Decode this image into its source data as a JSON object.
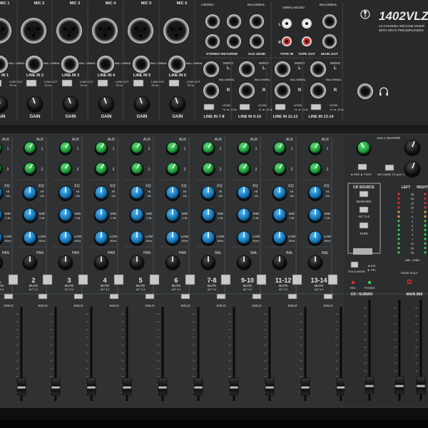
{
  "brand": {
    "model": "1402VLZ",
    "tagline_1": "14-CHANNEL MIC/LINE MIXER",
    "tagline_2": "WITH ONYX PREAMPLIFIERS"
  },
  "top_row": {
    "mic_labels": [
      "MIC 1",
      "MIC 2",
      "MIC 3",
      "MIC 4",
      "MIC 5",
      "MIC 6"
    ],
    "line_labels": [
      "LINE IN 1",
      "LINE IN 2",
      "LINE IN 3",
      "LINE IN 4",
      "LINE IN 5",
      "LINE IN 6"
    ],
    "low_cut": "LOW CUT",
    "low_cut_freq": "75 Hz",
    "gain": "GAIN",
    "bal_unbal": "BAL/ UNBAL",
    "stereo_returns": "STEREO RETURNS",
    "aux_send": "AUX SEND",
    "tape_in": "TAPE IN",
    "tape_out": "TAPE OUT",
    "main_out": "MAIN OUT",
    "unbalanced": "UNBALANCED",
    "l_mono": "L/MONO",
    "bal_unbal_short": "BAL/UNBAL",
    "mono": "MONO",
    "level": "LEVEL",
    "level_opts": "+4 ◄ -10 ►",
    "stereo_line_labels": [
      "LINE IN 7-8",
      "LINE IN 9-10",
      "LINE IN 11-12",
      "LINE IN 13-14"
    ],
    "l": "L",
    "r": "R"
  },
  "channels": {
    "numbers": [
      "1",
      "2",
      "3",
      "4",
      "5",
      "6",
      "7-8",
      "9-10",
      "11-12",
      "13-14"
    ],
    "aux": "AUX",
    "eq": "EQ",
    "hi": "HI",
    "hi_freq": "12k",
    "mid": "MID",
    "mid_freq": "2.5k",
    "low": "LOW",
    "low_freq": "80Hz",
    "pan": "PAN",
    "bal": "BAL",
    "mute": "MUTE",
    "alt": "ALT 3-4",
    "solo": "SOLO"
  },
  "master": {
    "aux1_master": "AUX 1 MASTER",
    "pre_post": "◄ PRE ► POST",
    "returns_to_aux1": "RETURNS TO AUX 1",
    "cr_source": "CR SOURCE",
    "main_mix": "MAIN MIX",
    "alt34": "ALT 3-4",
    "tape": "TAPE",
    "left": "LEFT",
    "right": "RIGHT",
    "solo_mode": "SOLO MODE",
    "afl": "◄ AFL",
    "pfl": "► PFL",
    "rude_solo": "RUDE SOLO",
    "rev": "REV",
    "power": "POWER",
    "cr_submix": "CR / SUBMIX",
    "main_mix_fader": "MAIN MIX",
    "meter_db": "0dB = 0dBu",
    "meter_values": [
      "28",
      "20",
      "15",
      "10",
      "7",
      "4",
      "2",
      "0",
      "2",
      "4",
      "7",
      "10",
      "20",
      "30"
    ]
  },
  "colors": {
    "panel": "#2b2d2e",
    "panel_light": "#3a3c3d",
    "knob_green": "#2fb04a",
    "knob_blue": "#1f8fd0",
    "knob_dark": "#1b1c1d",
    "led_green": "#38d04a",
    "led_red": "#e03030",
    "text": "#e6e6e6"
  },
  "icons": [
    "xlr-jack-icon",
    "trs-jack-icon",
    "rca-jack-icon",
    "headphone-icon",
    "mackie-logo-icon"
  ]
}
